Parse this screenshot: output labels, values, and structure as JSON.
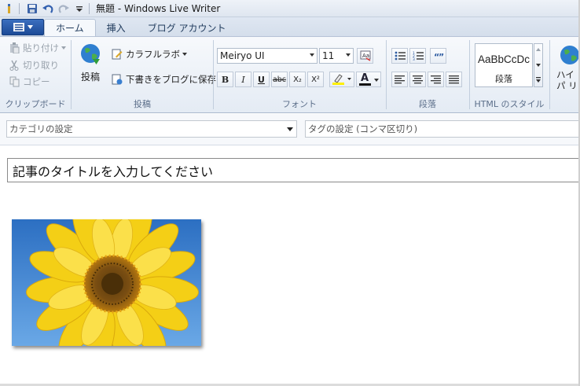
{
  "window": {
    "title": "無題 - Windows Live Writer"
  },
  "tabs": [
    {
      "label": "ホーム",
      "active": true
    },
    {
      "label": "挿入",
      "active": false
    },
    {
      "label": "ブログ アカウント",
      "active": false
    }
  ],
  "clipboard": {
    "label": "クリップボード",
    "paste": "貼り付け",
    "cut": "切り取り",
    "copy": "コピー"
  },
  "publish": {
    "label": "投稿",
    "publish_button": "投稿",
    "colorful_lab": "カラフルラボ",
    "save_draft": "下書きをブログに保存"
  },
  "font": {
    "label": "フォント",
    "family": "Meiryo UI",
    "size": "11",
    "bold": "B",
    "italic": "I",
    "underline": "U",
    "strike": "abc",
    "subscript": "X₂",
    "superscript": "X²",
    "font_color": "A"
  },
  "paragraph": {
    "label": "段落"
  },
  "html_style": {
    "label": "HTML のスタイル",
    "sample": "AaBbCcDc",
    "name": "段落"
  },
  "hyperlink": {
    "label": "ハイパ リン"
  },
  "category": {
    "placeholder": "カテゴリの設定"
  },
  "tags": {
    "placeholder": "タグの設定 (コンマ区切り)"
  },
  "editor": {
    "title_placeholder": "記事のタイトルを入力してください"
  },
  "colors": {
    "app_button": "#1c4a96",
    "highlight_yellow": "#ffef00",
    "font_color_bar": "#111111",
    "sky": "#3f86d6",
    "petal": "#f7d51d"
  }
}
